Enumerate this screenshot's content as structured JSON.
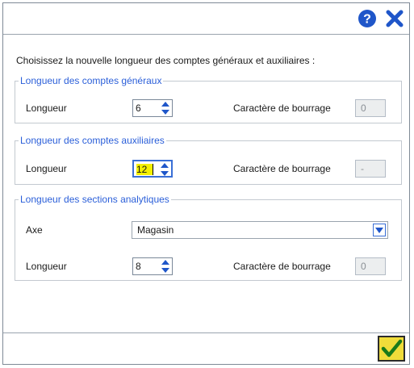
{
  "titlebar": {
    "help_icon": "help-icon",
    "close_icon": "close-icon"
  },
  "intro": "Choisissez la nouvelle longueur des comptes généraux et auxiliaires :",
  "groups": {
    "generaux": {
      "title": "Longueur des comptes généraux",
      "length_label": "Longueur",
      "length_value": "6",
      "pad_label": "Caractère de  bourrage",
      "pad_value": "0"
    },
    "auxiliaires": {
      "title": "Longueur des comptes auxiliaires",
      "length_label": "Longueur",
      "length_value": "12",
      "pad_label": "Caractère de bourrage",
      "pad_value": "-"
    },
    "analytiques": {
      "title": "Longueur des sections analytiques",
      "axe_label": "Axe",
      "axe_value": "Magasin",
      "length_label": "Longueur",
      "length_value": "8",
      "pad_label": "Caractère de bourrage",
      "pad_value": "0"
    }
  },
  "footer": {
    "ok_icon": "checkmark-icon"
  },
  "colors": {
    "accent": "#2b5fd9",
    "highlight": "#f4f000",
    "ok_button": "#f0dc3a"
  }
}
